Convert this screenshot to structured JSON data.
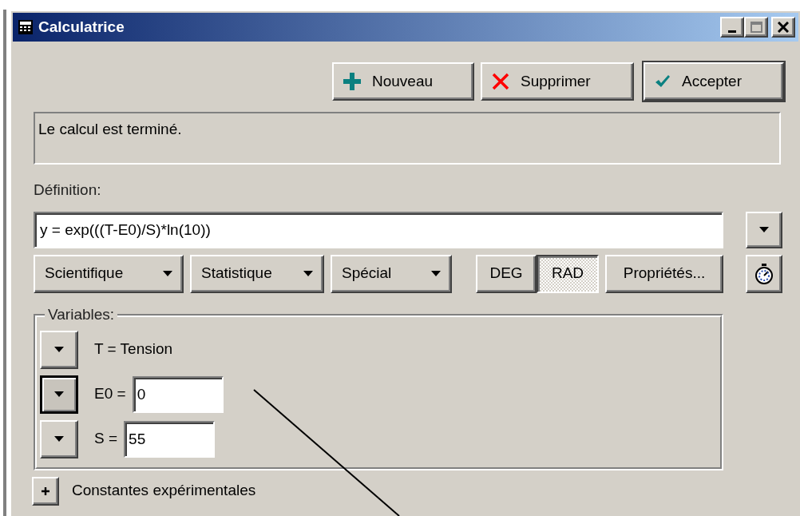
{
  "window": {
    "title": "Calculatrice"
  },
  "toolbar": [
    {
      "kind": "new",
      "label": "Nouveau"
    },
    {
      "kind": "delete",
      "label": "Supprimer"
    },
    {
      "kind": "accept",
      "label": "Accepter"
    }
  ],
  "status": "Le calcul est terminé.",
  "definition": {
    "label": "Définition:",
    "value": "y = exp(((T-E0)/S)*ln(10))"
  },
  "function_menus": [
    {
      "label": "Scientifique"
    },
    {
      "label": "Statistique"
    },
    {
      "label": "Spécial"
    }
  ],
  "angle_modes": [
    {
      "label": "DEG",
      "selected": false
    },
    {
      "label": "RAD",
      "selected": true
    }
  ],
  "properties_button": {
    "label": "Propriétés..."
  },
  "variables": {
    "title": "Variables:",
    "items": [
      {
        "kind": "text",
        "text": "T = Tension",
        "focused": false
      },
      {
        "kind": "input",
        "label": "E0 =",
        "value": "0",
        "focused": true
      },
      {
        "kind": "input",
        "label": "S =",
        "value": "55",
        "focused": false
      }
    ]
  },
  "constants": {
    "label": "Constantes expérimentales",
    "expanded": false
  }
}
